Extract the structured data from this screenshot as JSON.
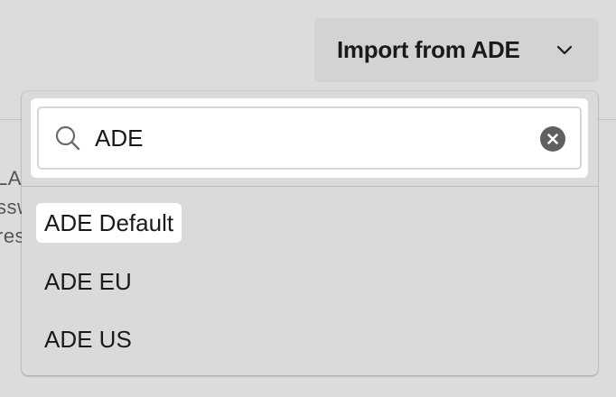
{
  "import_button": {
    "label": "Import from ADE",
    "icon": "chevron-down-icon"
  },
  "background_fragments": [
    "LA",
    "ssw",
    "res"
  ],
  "search": {
    "value": "ADE",
    "icon": "search-icon",
    "clear_icon": "clear-icon"
  },
  "options": [
    {
      "label": "ADE Default",
      "highlighted": true
    },
    {
      "label": "ADE EU",
      "highlighted": false
    },
    {
      "label": "ADE US",
      "highlighted": false
    }
  ]
}
